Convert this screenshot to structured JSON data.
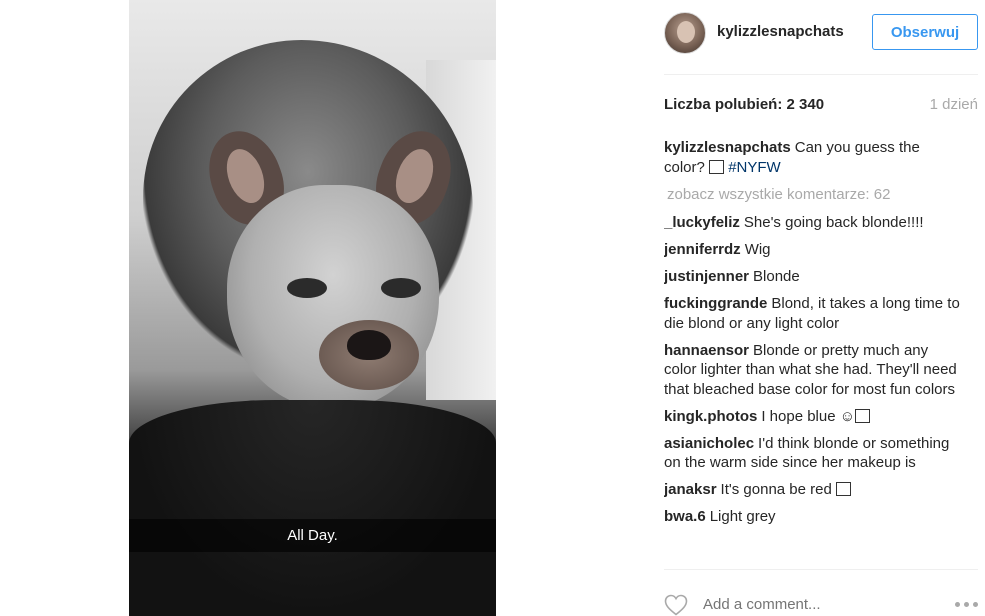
{
  "post": {
    "caption_overlay": "All Day.",
    "image_alt": "snapchat dog filter selfie"
  },
  "header": {
    "username": "kylizzlesnapchats",
    "follow_label": "Obserwuj"
  },
  "stats": {
    "likes": "Liczba polubień: 2 340",
    "time": "1 dzień"
  },
  "caption": {
    "user": "kylizzlesnapchats",
    "text": "Can you guess the color?",
    "hashtag": "#NYFW"
  },
  "view_all_comments": "zobacz wszystkie komentarze: 62",
  "comments": [
    {
      "user": "_luckyfeliz",
      "text": "She's going back blonde!!!!"
    },
    {
      "user": "jenniferrdz",
      "text": "Wig"
    },
    {
      "user": "justinjenner",
      "text": "Blonde"
    },
    {
      "user": "fuckinggrande",
      "text": "Blond, it takes a long time to die blond or any light color"
    },
    {
      "user": "hannaensor",
      "text": "Blonde or pretty much any color lighter than what she had. They'll need that bleached base color for most fun colors"
    },
    {
      "user": "kingk.photos",
      "text": "I hope blue"
    },
    {
      "user": "asianicholec",
      "text": "I'd think blonde or something on the warm side since her makeup is"
    },
    {
      "user": "janaksr",
      "text": "It's gonna be red"
    },
    {
      "user": "bwa.6",
      "text": "Light grey"
    }
  ],
  "footer": {
    "comment_placeholder": "Add a comment..."
  },
  "colors": {
    "accent": "#3897f0",
    "hashtag": "#003569",
    "muted": "#a9a9a9",
    "text": "#262626"
  },
  "icons": {
    "like": "heart-outline-icon",
    "options": "more-options-icon",
    "emoji": "emoji-glyph-icon"
  }
}
